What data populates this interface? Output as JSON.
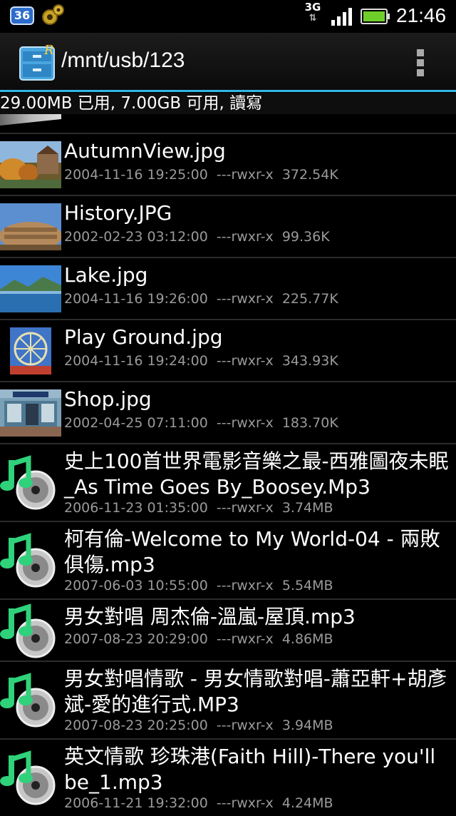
{
  "status_bar": {
    "notification_count": "36",
    "network_type": "3G",
    "time": "21:46"
  },
  "action_bar": {
    "path": "/mnt/usb/123"
  },
  "storage_info": "29.00MB 已用, 7.00GB 可用, 讀寫",
  "files": [
    {
      "name": "AutumnView.jpg",
      "date": "2004-11-16 19:25:00",
      "perm": "---rwxr-x",
      "size": "372.54K",
      "type": "image",
      "thumb": "autumn"
    },
    {
      "name": "History.JPG",
      "date": "2002-02-23 03:12:00",
      "perm": "---rwxr-x",
      "size": "99.36K",
      "type": "image",
      "thumb": "history"
    },
    {
      "name": "Lake.jpg",
      "date": "2004-11-16 19:26:00",
      "perm": "---rwxr-x",
      "size": "225.77K",
      "type": "image",
      "thumb": "lake"
    },
    {
      "name": "Play Ground.jpg",
      "date": "2004-11-16 19:24:00",
      "perm": "---rwxr-x",
      "size": "343.93K",
      "type": "image",
      "thumb": "playground"
    },
    {
      "name": "Shop.jpg",
      "date": "2002-04-25 07:11:00",
      "perm": "---rwxr-x",
      "size": "183.70K",
      "type": "image",
      "thumb": "shop"
    },
    {
      "name": "史上100首世界電影音樂之最-西雅圖夜未眠_As Time Goes By_Boosey.Mp3",
      "date": "2006-11-23 01:35:00",
      "perm": "---rwxr-x",
      "size": "3.74MB",
      "type": "music"
    },
    {
      "name": "柯有倫-Welcome to My World-04 - 兩敗俱傷.mp3",
      "date": "2007-06-03 10:55:00",
      "perm": "---rwxr-x",
      "size": "5.54MB",
      "type": "music"
    },
    {
      "name": "男女對唱 周杰倫-溫嵐-屋頂.mp3",
      "date": "2007-08-23 20:29:00",
      "perm": "---rwxr-x",
      "size": "4.86MB",
      "type": "music"
    },
    {
      "name": "男女對唱情歌 - 男女情歌對唱-蕭亞軒+胡彥斌-愛的進行式.MP3",
      "date": "2007-08-23 20:25:00",
      "perm": "---rwxr-x",
      "size": "3.94MB",
      "type": "music"
    },
    {
      "name": "英文情歌 珍珠港(Faith Hill)-There you'll be_1.mp3",
      "date": "2006-11-21 19:32:00",
      "perm": "---rwxr-x",
      "size": "4.24MB",
      "type": "music"
    }
  ],
  "colors": {
    "accent": "#33b5e5",
    "music_note": "#2fd27a"
  }
}
